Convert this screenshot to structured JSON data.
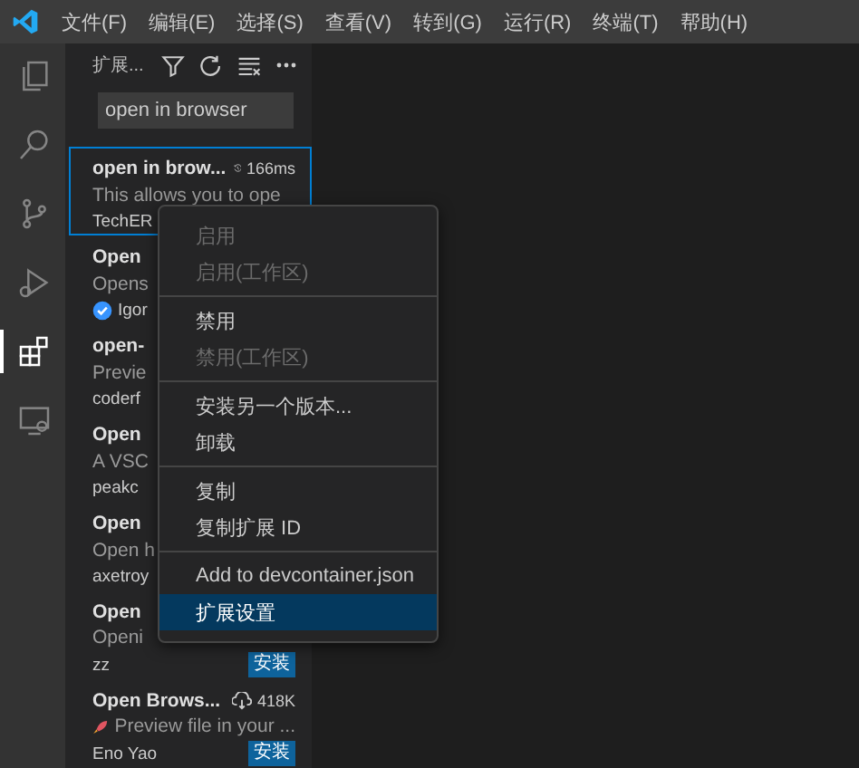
{
  "menubar": [
    "文件(F)",
    "编辑(E)",
    "选择(S)",
    "查看(V)",
    "转到(G)",
    "运行(R)",
    "终端(T)",
    "帮助(H)"
  ],
  "activity_bar": [
    {
      "selected": false
    },
    {
      "selected": false
    },
    {
      "selected": false
    },
    {
      "selected": false
    },
    {
      "selected": true
    },
    {
      "selected": false
    }
  ],
  "sidebar": {
    "title": "扩展...",
    "search": {
      "value": "open in browser"
    },
    "extensions": [
      {
        "title": "open in brow...",
        "meta": {
          "kind": "time",
          "text": "166ms"
        },
        "description": "This allows you to ope",
        "author": "TechER",
        "verified": false,
        "selected": true
      },
      {
        "title": "Open",
        "description": "Opens",
        "author": "Igor",
        "verified": true,
        "selected": false
      },
      {
        "title": "open-",
        "description": "Previe",
        "author": "coderf",
        "verified": false,
        "selected": false
      },
      {
        "title": "Open",
        "description": "A VSC",
        "author": "peakc",
        "verified": false,
        "selected": false
      },
      {
        "title": "Open",
        "description": "Open h",
        "author": "axetroy",
        "verified": false,
        "selected": false
      },
      {
        "title": "Open",
        "description": "Openi",
        "author": "zz",
        "verified": false,
        "install": "安装",
        "selected": false
      },
      {
        "title": "Open Brows...",
        "meta": {
          "kind": "downloads",
          "text": "418K"
        },
        "description": "Preview file in your ...",
        "desc_icon": true,
        "author": "Eno Yao",
        "verified": false,
        "install": "安装",
        "selected": false
      }
    ]
  },
  "context_menu": [
    {
      "kind": "item",
      "label": "启用",
      "disabled": true,
      "selected": false
    },
    {
      "kind": "item",
      "label": "启用(工作区)",
      "disabled": true,
      "selected": false
    },
    {
      "kind": "separator"
    },
    {
      "kind": "item",
      "label": "禁用",
      "disabled": false,
      "selected": false
    },
    {
      "kind": "item",
      "label": "禁用(工作区)",
      "disabled": true,
      "selected": false
    },
    {
      "kind": "separator"
    },
    {
      "kind": "item",
      "label": "安装另一个版本...",
      "disabled": false,
      "selected": false
    },
    {
      "kind": "item",
      "label": "卸载",
      "disabled": false,
      "selected": false
    },
    {
      "kind": "separator"
    },
    {
      "kind": "item",
      "label": "复制",
      "disabled": false,
      "selected": false
    },
    {
      "kind": "item",
      "label": "复制扩展 ID",
      "disabled": false,
      "selected": false
    },
    {
      "kind": "separator"
    },
    {
      "kind": "item",
      "label": "Add to devcontainer.json",
      "disabled": false,
      "selected": false
    },
    {
      "kind": "item",
      "label": "扩展设置",
      "disabled": false,
      "selected": true
    }
  ]
}
